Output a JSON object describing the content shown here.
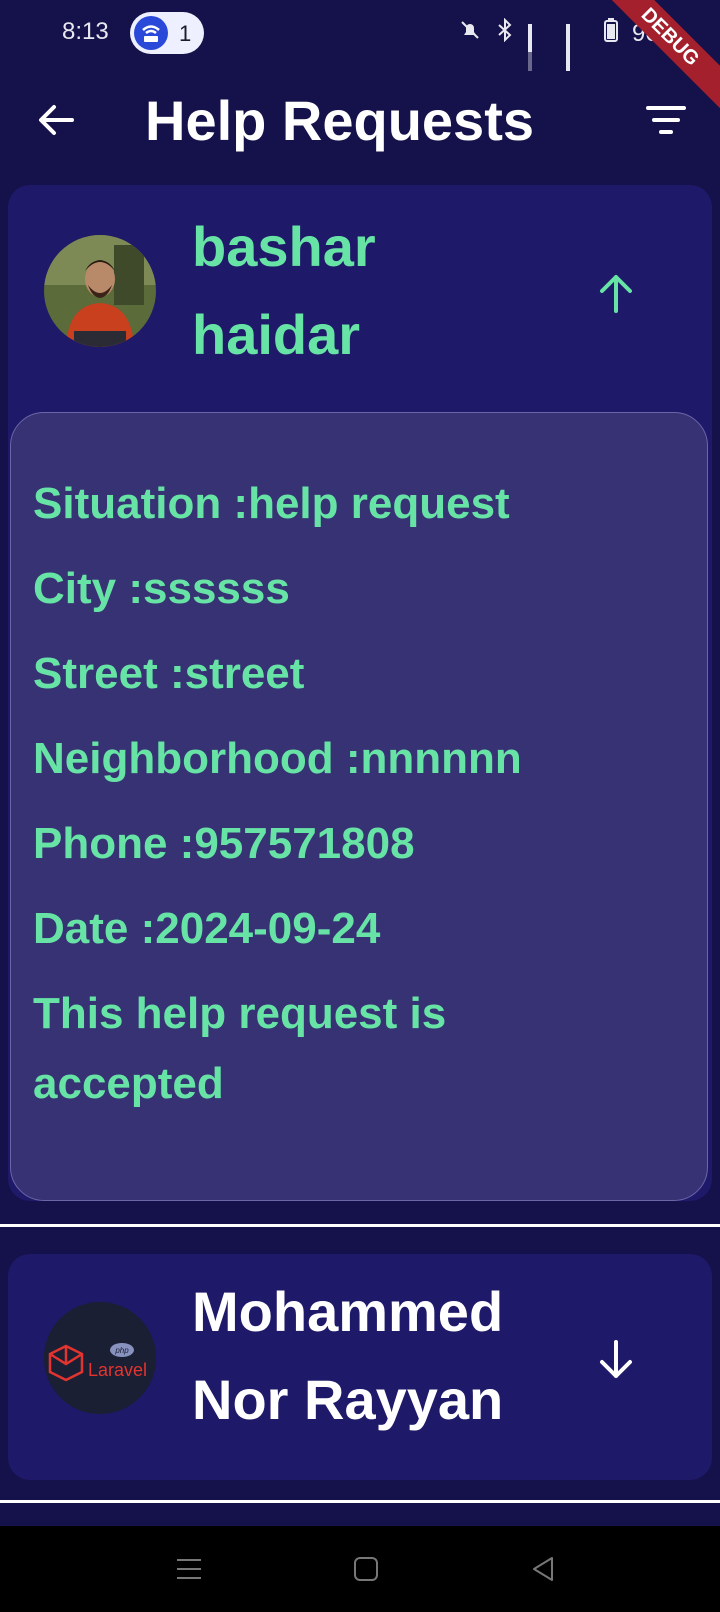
{
  "status_bar": {
    "time": "8:13",
    "notification_count": "1",
    "battery_percent": "96%",
    "debug_label": "DEBUG"
  },
  "app_bar": {
    "title": "Help Requests",
    "back_icon": "arrow-left-icon",
    "filter_icon": "filter-icon"
  },
  "requests": [
    {
      "first_name": "bashar",
      "last_name": "haidar",
      "expanded": true,
      "toggle_icon": "arrow-up-icon",
      "details": {
        "situation": "Situation :help request",
        "city": "City :ssssss",
        "street": "Street :street",
        "neighborhood": "Neighborhood :nnnnnn",
        "phone": "Phone :957571808",
        "date": "Date :2024-09-24",
        "status_line1": "This help request is",
        "status_line2": "accepted"
      }
    },
    {
      "first_name": "Mohammed",
      "last_name": "Nor Rayyan",
      "expanded": false,
      "toggle_icon": "arrow-down-icon",
      "avatar_text": "Laravel",
      "avatar_badge": "php"
    }
  ],
  "colors": {
    "background": "#15114a",
    "card": "#1f1969",
    "details_panel": "#373274",
    "accent": "#67e3a6"
  }
}
